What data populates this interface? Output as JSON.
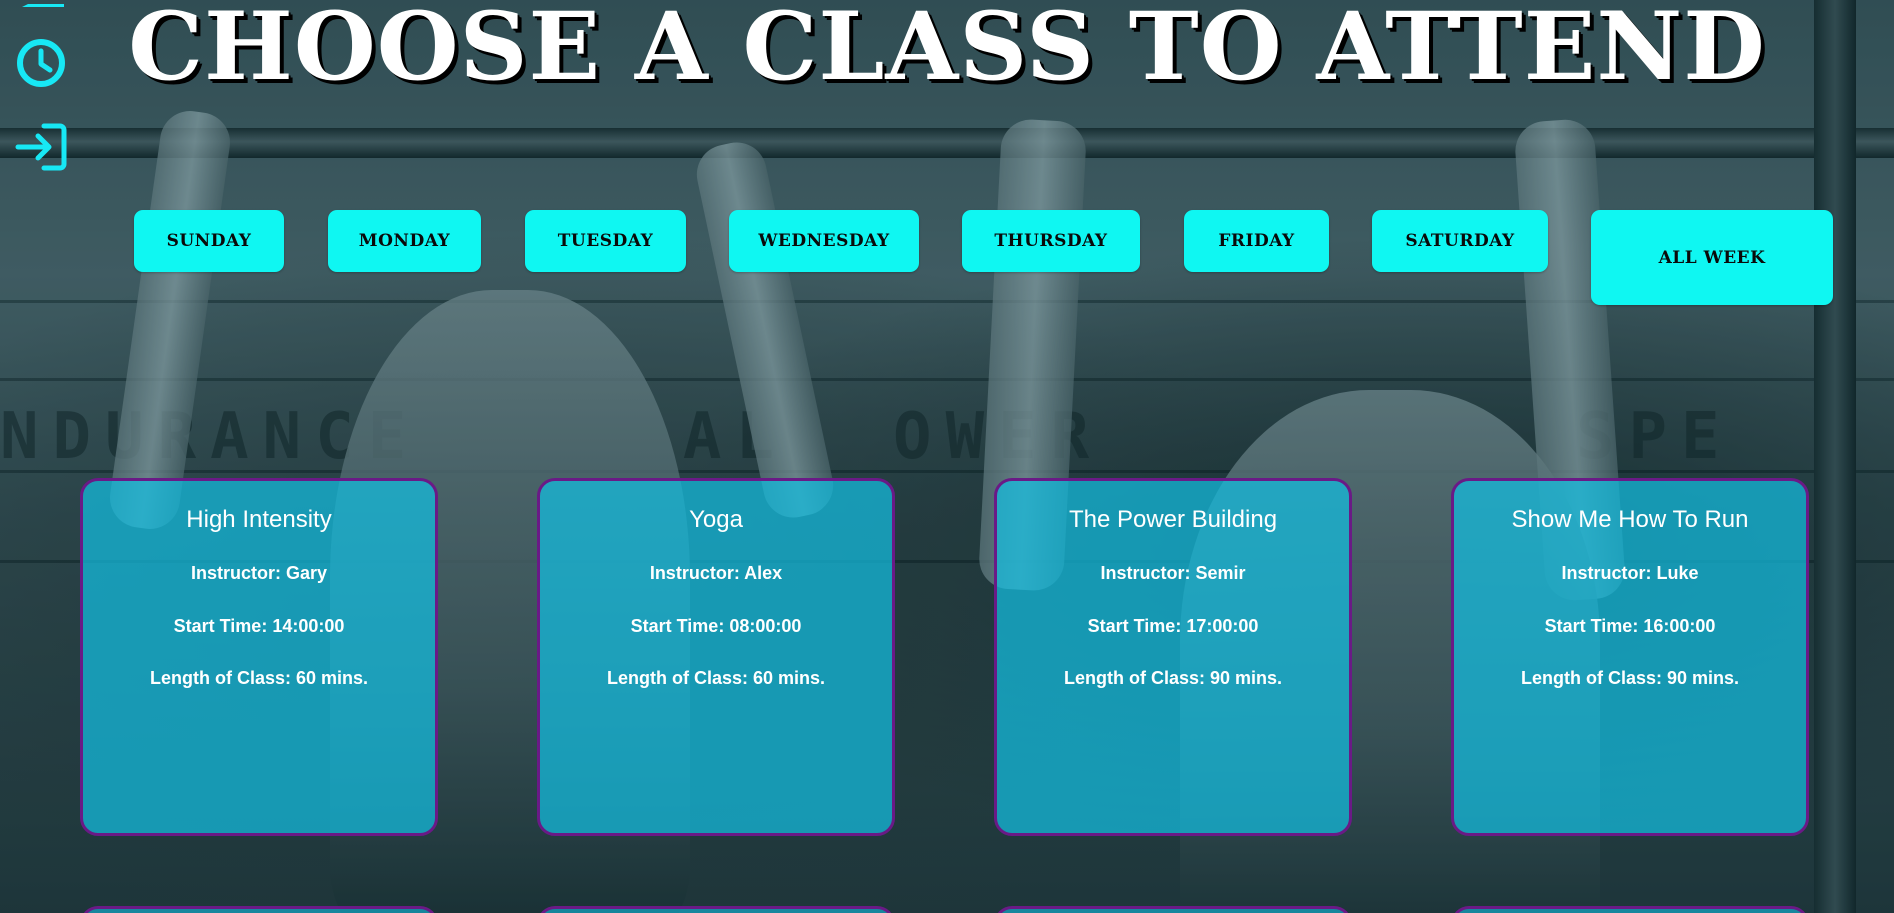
{
  "header": {
    "title": "CHOOSE A CLASS TO ATTEND"
  },
  "sidebar": {
    "icons": [
      "clock-icon",
      "sign-in-icon"
    ]
  },
  "days": [
    {
      "label": "SUNDAY"
    },
    {
      "label": "MONDAY"
    },
    {
      "label": "TUESDAY"
    },
    {
      "label": "WEDNESDAY"
    },
    {
      "label": "THURSDAY"
    },
    {
      "label": "FRIDAY"
    },
    {
      "label": "SATURDAY"
    },
    {
      "label": "ALL WEEK"
    }
  ],
  "classes": [
    {
      "name": "High Intensity",
      "instructor": "Instructor: Gary",
      "start": "Start Time: 14:00:00",
      "length": "Length of Class: 60 mins."
    },
    {
      "name": "Yoga",
      "instructor": "Instructor: Alex",
      "start": "Start Time: 08:00:00",
      "length": "Length of Class: 60 mins."
    },
    {
      "name": "The Power Building",
      "instructor": "Instructor: Semir",
      "start": "Start Time: 17:00:00",
      "length": "Length of Class: 90 mins."
    },
    {
      "name": "Show Me How To Run",
      "instructor": "Instructor: Luke",
      "start": "Start Time: 16:00:00",
      "length": "Length of Class: 90 mins."
    }
  ],
  "theme": {
    "accent": "#0ff7f2",
    "icon_color": "#17e8f5",
    "card_bg": "#14bee1",
    "card_border": "#6a1a86",
    "title_color": "#ffffff"
  }
}
